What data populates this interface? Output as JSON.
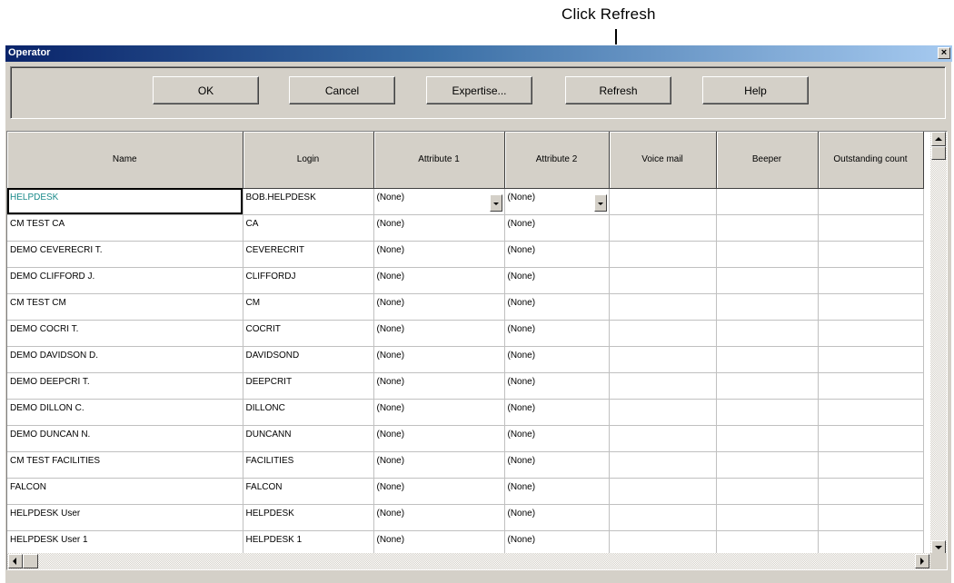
{
  "annotation": {
    "text": "Click Refresh"
  },
  "window": {
    "title": "Operator",
    "close_label": "×"
  },
  "toolbar": {
    "buttons": [
      {
        "label": "OK"
      },
      {
        "label": "Cancel"
      },
      {
        "label": "Expertise..."
      },
      {
        "label": "Refresh"
      },
      {
        "label": "Help"
      }
    ]
  },
  "grid": {
    "columns": [
      "Name",
      "Login",
      "Attribute 1",
      "Attribute 2",
      "Voice mail",
      "Beeper",
      "Outstanding count"
    ],
    "rows": [
      [
        "HELPDESK",
        "BOB.HELPDESK",
        "(None)",
        "(None)",
        "",
        "",
        ""
      ],
      [
        "CM TEST CA",
        "CA",
        "(None)",
        "(None)",
        "",
        "",
        ""
      ],
      [
        "DEMO CEVERECRI T.",
        "CEVERECRIT",
        "(None)",
        "(None)",
        "",
        "",
        ""
      ],
      [
        "DEMO CLIFFORD J.",
        "CLIFFORDJ",
        "(None)",
        "(None)",
        "",
        "",
        ""
      ],
      [
        "CM TEST CM",
        "CM",
        "(None)",
        "(None)",
        "",
        "",
        ""
      ],
      [
        "DEMO COCRI T.",
        "COCRIT",
        "(None)",
        "(None)",
        "",
        "",
        ""
      ],
      [
        "DEMO DAVIDSON D.",
        "DAVIDSOND",
        "(None)",
        "(None)",
        "",
        "",
        ""
      ],
      [
        "DEMO DEEPCRI T.",
        "DEEPCRIT",
        "(None)",
        "(None)",
        "",
        "",
        ""
      ],
      [
        "DEMO DILLON C.",
        "DILLONC",
        "(None)",
        "(None)",
        "",
        "",
        ""
      ],
      [
        "DEMO DUNCAN N.",
        "DUNCANN",
        "(None)",
        "(None)",
        "",
        "",
        ""
      ],
      [
        "CM TEST FACILITIES",
        "FACILITIES",
        "(None)",
        "(None)",
        "",
        "",
        ""
      ],
      [
        "FALCON",
        "FALCON",
        "(None)",
        "(None)",
        "",
        "",
        ""
      ],
      [
        "HELPDESK User",
        "HELPDESK",
        "(None)",
        "(None)",
        "",
        "",
        ""
      ],
      [
        "HELPDESK User 1",
        "HELPDESK 1",
        "(None)",
        "(None)",
        "",
        "",
        ""
      ]
    ],
    "selected_text_color": "#1a8a8a"
  },
  "icons": {
    "close": "close-icon",
    "dropdown": "chevron-down-icon",
    "scroll_up": "arrow-up-icon",
    "scroll_down": "arrow-down-icon",
    "scroll_left": "arrow-left-icon",
    "scroll_right": "arrow-right-icon"
  },
  "colors": {
    "title_bar_start": "#0a246a",
    "title_bar_end": "#a6caf0",
    "face": "#d4d0c8"
  }
}
